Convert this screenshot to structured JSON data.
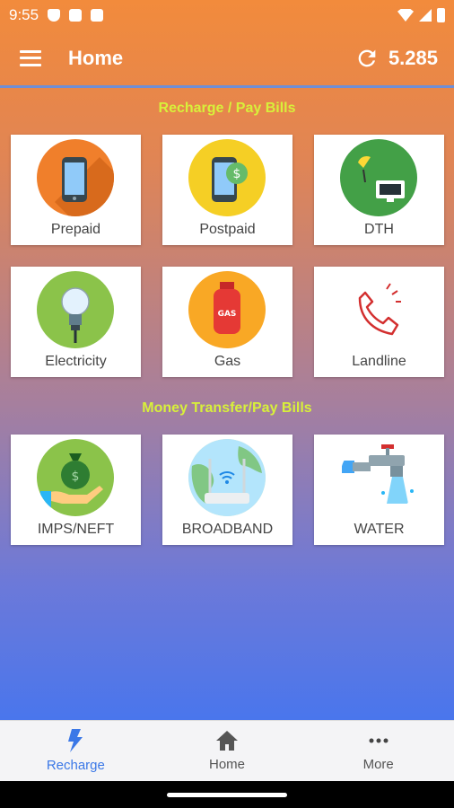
{
  "status_bar": {
    "time": "9:55"
  },
  "app_bar": {
    "title": "Home",
    "balance": "5.285"
  },
  "sections": {
    "recharge": "Recharge / Pay Bills",
    "money": "Money Transfer/Pay Bills"
  },
  "tiles": {
    "prepaid": "Prepaid",
    "postpaid": "Postpaid",
    "dth": "DTH",
    "electricity": "Electricity",
    "gas": "Gas",
    "landline": "Landline",
    "imps": "IMPS/NEFT",
    "broadband": "BROADBAND",
    "water": "WATER"
  },
  "bottom_nav": {
    "recharge": "Recharge",
    "home": "Home",
    "more": "More"
  },
  "colors": {
    "accent": "#3b78e7",
    "section_title": "#d8f03a",
    "prepaid_bg": "#f07f2b",
    "postpaid_bg": "#f5cf25",
    "dth_bg": "#43a047",
    "electricity_bg": "#8bc34a",
    "gas_bg": "#f9a825",
    "imps_bg": "#8bc34a"
  },
  "icons": {
    "prepaid": "mobile-phone-icon",
    "postpaid": "mobile-dollar-icon",
    "dth": "satellite-tv-icon",
    "electricity": "light-bulb-icon",
    "gas": "gas-cylinder-icon",
    "landline": "telephone-icon",
    "imps": "money-bag-hand-icon",
    "broadband": "wifi-router-icon",
    "water": "water-tap-icon"
  }
}
